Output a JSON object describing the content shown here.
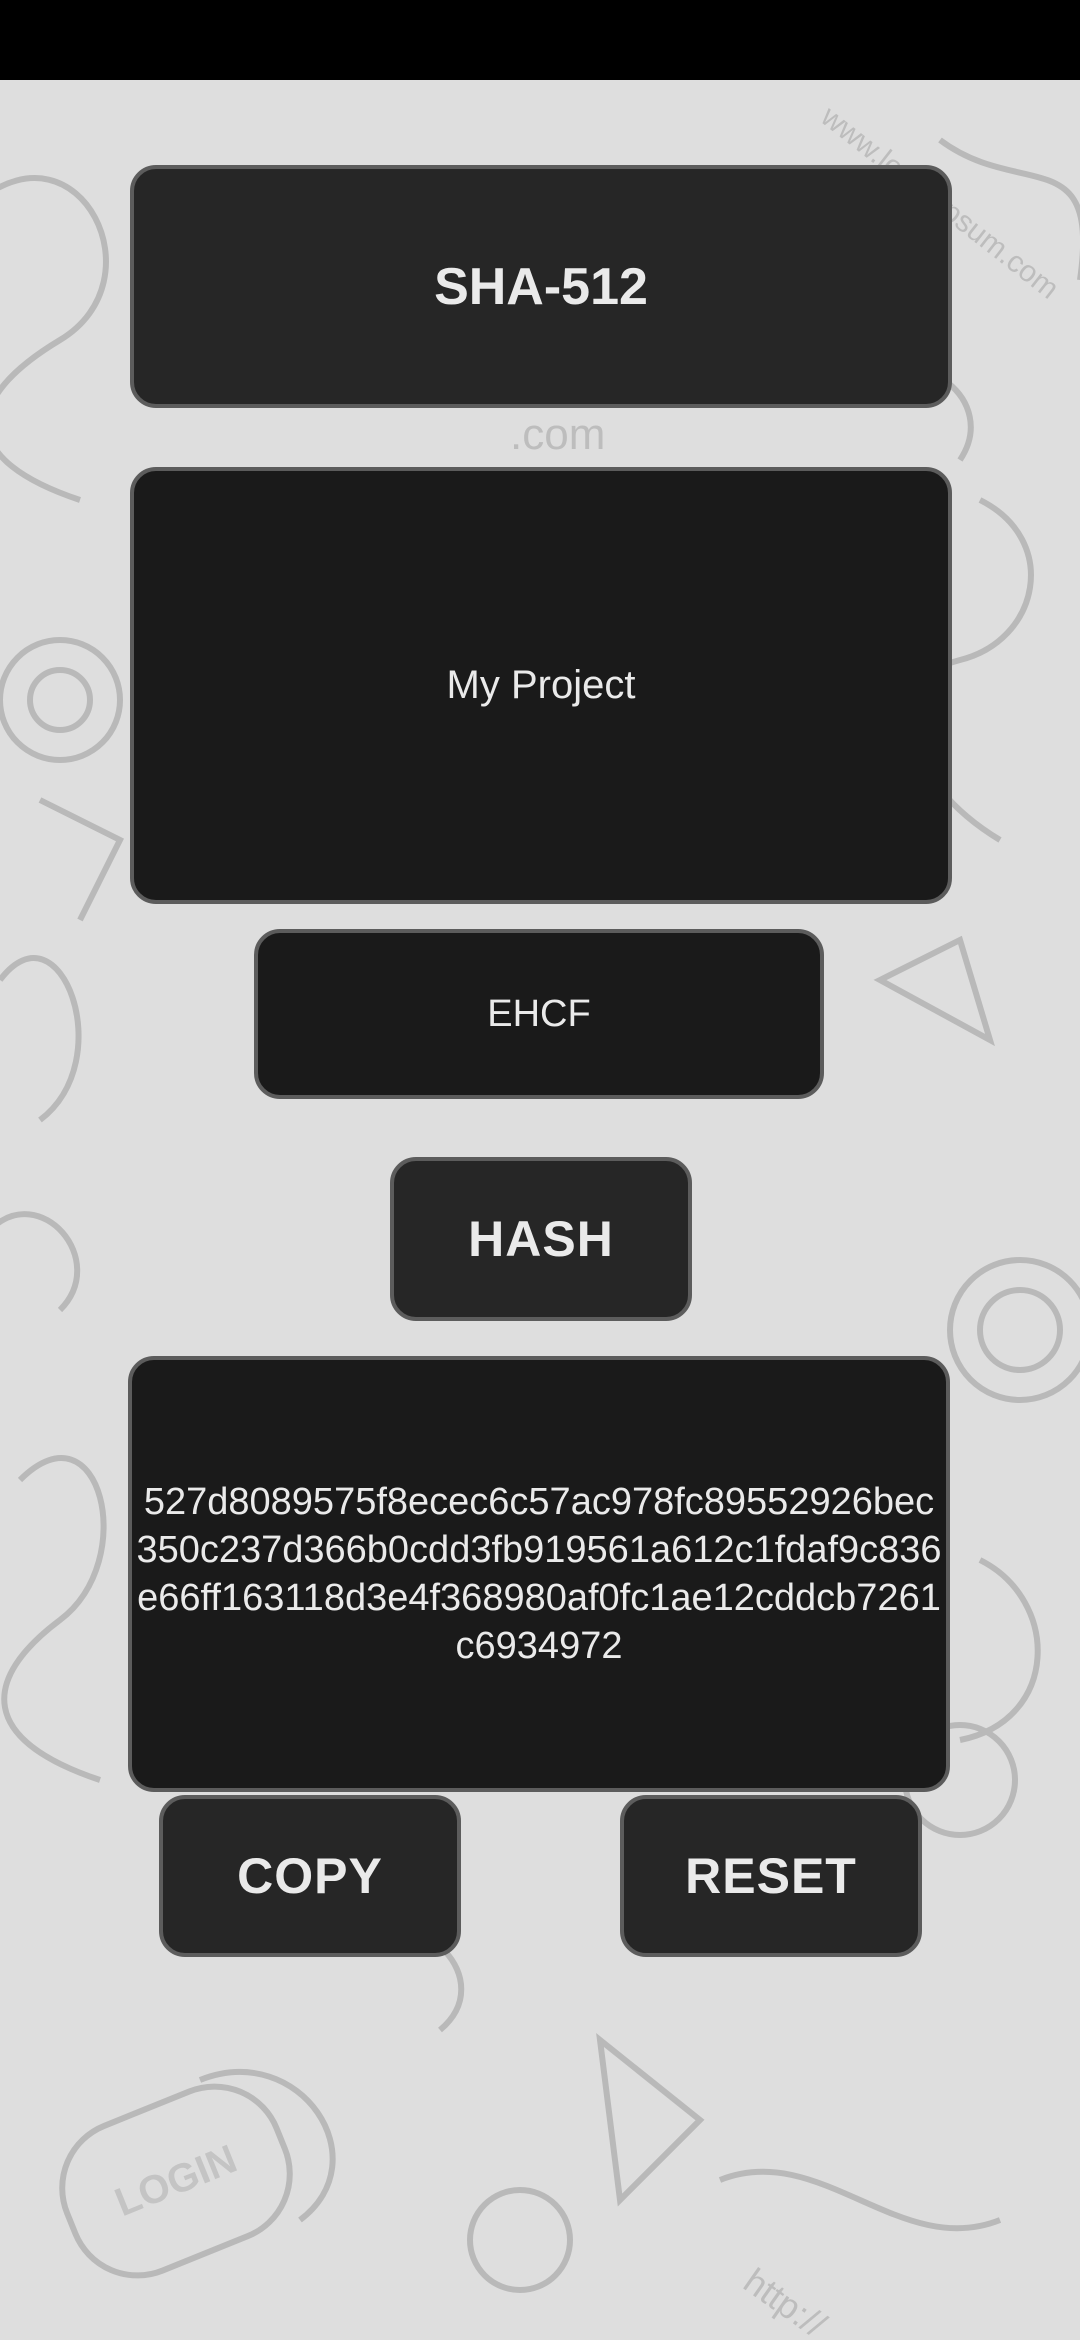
{
  "header": {
    "title": "SHA-512"
  },
  "input": {
    "text": "My Project"
  },
  "code": {
    "value": "EHCF"
  },
  "actions": {
    "hash_label": "HASH",
    "copy_label": "COPY",
    "reset_label": "RESET"
  },
  "output": {
    "hash": "527d8089575f8ecec6c57ac978fc89552926bec350c237d366b0cdd3fb919561a612c1fdaf9c836e66ff163118d3e4f368980af0fc1ae12cddcb7261c6934972"
  },
  "background": {
    "watermark_top": "www.loremipsum.com",
    "watermark_mid": ".com",
    "login_badge": "LOGIN",
    "watermark_bottom": "http://"
  },
  "colors": {
    "status_bar": "#000000",
    "background": "#dedede",
    "panel": "#262626",
    "field": "#1a1a1a",
    "border": "#5c5c5c",
    "text": "#eaeaea"
  }
}
